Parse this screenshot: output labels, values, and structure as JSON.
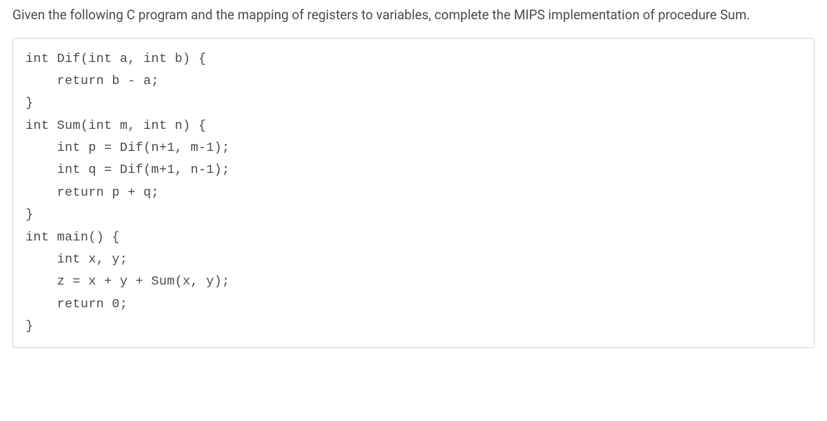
{
  "question": {
    "text": "Given the following C program and the mapping of registers to variables, complete the MIPS implementation of procedure Sum."
  },
  "code": {
    "lines": [
      "int Dif(int a, int b) {",
      "    return b - a;",
      "}",
      "",
      "int Sum(int m, int n) {",
      "    int p = Dif(n+1, m-1);",
      "    int q = Dif(m+1, n-1);",
      "    return p + q;",
      "}",
      "",
      "int main() {",
      "    int x, y;",
      "    z = x + y + Sum(x, y);",
      "    return 0;",
      "}"
    ]
  }
}
